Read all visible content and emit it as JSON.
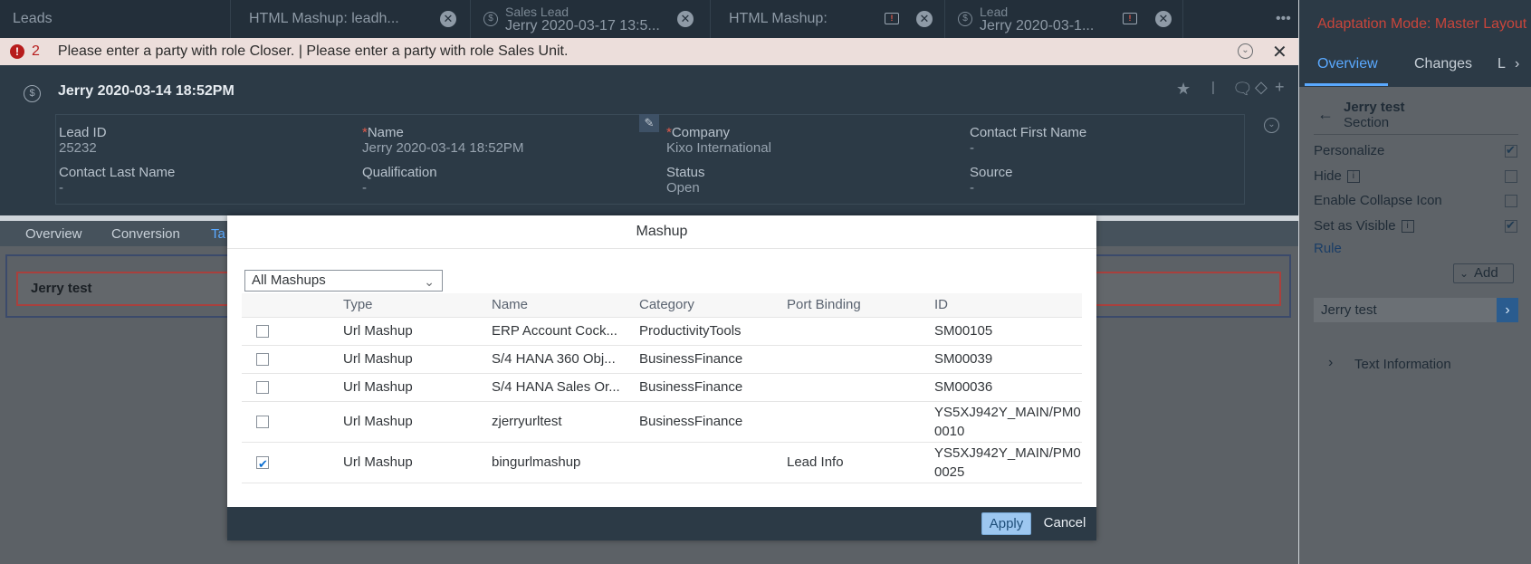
{
  "tabs": [
    {
      "label": "Leads"
    },
    {
      "label": "HTML Mashup: leadh..."
    },
    {
      "sub": "Sales Lead",
      "label": "Jerry 2020-03-17 13:5..."
    },
    {
      "label": "HTML Mashup:"
    },
    {
      "sub": "Lead",
      "label": "Jerry 2020-03-1..."
    }
  ],
  "message_bar": {
    "count": "2",
    "text": "Please enter a party with role Closer. | Please enter a party with role Sales Unit."
  },
  "header": {
    "title": "Jerry 2020-03-14 18:52PM",
    "fields": [
      {
        "label": "Lead ID",
        "value": "25232",
        "required": false
      },
      {
        "label": "Name",
        "value": "Jerry 2020-03-14 18:52PM",
        "required": true
      },
      {
        "label": "Company",
        "value": "Kixo International",
        "required": true
      },
      {
        "label": "Contact First Name",
        "value": "-",
        "required": false
      },
      {
        "label": "Contact Last Name",
        "value": "-",
        "required": false
      },
      {
        "label": "Qualification",
        "value": "-",
        "required": false
      },
      {
        "label": "Status",
        "value": "Open",
        "required": false
      },
      {
        "label": "Source",
        "value": "-",
        "required": false
      }
    ]
  },
  "subtabs": [
    "Overview",
    "Conversion",
    "Ta"
  ],
  "section": {
    "title": "Jerry test"
  },
  "right_panel": {
    "title": "Adaptation Mode: Master Layout",
    "tabs": [
      "Overview",
      "Changes",
      "L"
    ],
    "back_title": "Jerry test",
    "back_subtitle": "Section",
    "options": [
      {
        "label": "Personalize",
        "checked": true,
        "info": false
      },
      {
        "label": "Hide",
        "checked": false,
        "info": true
      },
      {
        "label": "Enable Collapse Icon",
        "checked": false,
        "info": false
      },
      {
        "label": "Set as Visible",
        "checked": true,
        "info": true
      }
    ],
    "rule_label": "Rule",
    "add_label": "Add",
    "section_item": "Jerry test",
    "text_information": "Text Information"
  },
  "modal": {
    "title": "Mashup",
    "filter_value": "All Mashups",
    "columns": [
      "Type",
      "Name",
      "Category",
      "Port Binding",
      "ID"
    ],
    "rows": [
      {
        "checked": false,
        "type": "Url Mashup",
        "name": "ERP Account Cock...",
        "category": "ProductivityTools",
        "port_binding": "",
        "id": "SM00105"
      },
      {
        "checked": false,
        "type": "Url Mashup",
        "name": "S/4 HANA 360 Obj...",
        "category": "BusinessFinance",
        "port_binding": "",
        "id": "SM00039"
      },
      {
        "checked": false,
        "type": "Url Mashup",
        "name": "S/4 HANA Sales Or...",
        "category": "BusinessFinance",
        "port_binding": "",
        "id": "SM00036"
      },
      {
        "checked": false,
        "type": "Url Mashup",
        "name": "zjerryurltest",
        "category": "BusinessFinance",
        "port_binding": "",
        "id": "YS5XJ942Y_MAIN/PM00010"
      },
      {
        "checked": true,
        "type": "Url Mashup",
        "name": "bingurlmashup",
        "category": "",
        "port_binding": "Lead Info",
        "id": "YS5XJ942Y_MAIN/PM00025"
      }
    ],
    "apply_label": "Apply",
    "cancel_label": "Cancel"
  }
}
